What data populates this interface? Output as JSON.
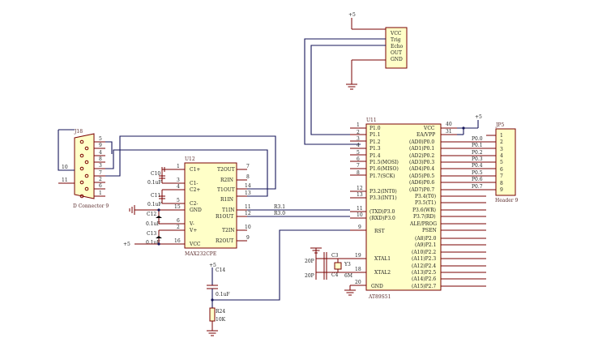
{
  "power": {
    "plus5": "+5"
  },
  "sensor": {
    "pins": [
      "VCC",
      "Trig",
      "Echo",
      "OUT",
      "GND"
    ]
  },
  "u11": {
    "ref": "U11",
    "name": "AT89S51",
    "vcc_pin": "40",
    "ea_pin": "31",
    "left_pins": [
      "P1.0",
      "P1.1",
      "P1.2",
      "P1.3",
      "P1.4",
      "P1.5(MOSI)",
      "P1.6(MISO)",
      "P1.7(SCK)"
    ],
    "left_nums": [
      "1",
      "2",
      "3",
      "4",
      "5",
      "6",
      "7",
      "8"
    ],
    "int_pins": [
      "P3.2(INT0)",
      "P3.3(INT1)"
    ],
    "int_nums": [
      "12",
      "13"
    ],
    "uart_pins": [
      "(TXD)P3.0",
      "(RXD)P3.0"
    ],
    "uart_nums": [
      "11",
      "10"
    ],
    "rst": {
      "label": "RST",
      "num": "9"
    },
    "xtal1": {
      "label": "XTAL1",
      "num": "19"
    },
    "xtal2": {
      "label": "XTAL2",
      "num": "18"
    },
    "gnd": {
      "label": "GND",
      "num": "20"
    },
    "right_top": [
      "VCC",
      "EA/VPP",
      "(AD0)P0.0",
      "(AD1)P0.1",
      "(AD2)P0.2",
      "(AD3)P0.3",
      "(AD4)P0.4",
      "(AD5)P0.5",
      "(AD6)P0.6",
      "(AD7)P0.7",
      "P3.4(T0)",
      "P3.5(T1)",
      "P3.6(WR)",
      "P3.7(RD)",
      "ALE/PROG",
      "PSEN"
    ],
    "right_bottom": [
      "(A8)P2.0",
      "(A9)P2.1",
      "(A10)P2.2",
      "(A11)P2.3",
      "(A12)P2.4",
      "(A13)P2.5",
      "(A14)P2.6",
      "(A15)P2.7"
    ]
  },
  "jp5": {
    "ref": "JP5",
    "name": "Header 9",
    "nets": [
      "P0.0",
      "P0.1",
      "P0.2",
      "P0.3",
      "P0.4",
      "P0.5",
      "P0.6",
      "P0.7"
    ],
    "nums": [
      "1",
      "2",
      "3",
      "4",
      "5",
      "6",
      "7",
      "8",
      "9"
    ]
  },
  "j18": {
    "ref": "J18",
    "name": "D Connector 9",
    "pins": [
      "5",
      "9",
      "4",
      "8",
      "3",
      "7",
      "2",
      "6",
      "1"
    ],
    "side_nums": [
      "10",
      "11"
    ]
  },
  "u12": {
    "ref": "U12",
    "name": "MAX232CPE",
    "left_labels": [
      "C1+",
      "C1-",
      "C2+",
      "C2-",
      "GND",
      "V-",
      "V+",
      "VCC"
    ],
    "left_nums": [
      "1",
      "3",
      "4",
      "5",
      "15",
      "6",
      "2",
      "16"
    ],
    "right_labels": [
      "T2OUT",
      "R2IN",
      "T1OUT",
      "R1IN",
      "T1IN",
      "R1OUT",
      "T2IN",
      "R2OUT"
    ],
    "right_nums": [
      "7",
      "8",
      "14",
      "13",
      "11",
      "12",
      "10",
      "9"
    ]
  },
  "caps_max": [
    {
      "ref": "C10",
      "value": "0.1uF"
    },
    {
      "ref": "C11",
      "value": "0.1uF"
    },
    {
      "ref": "C12",
      "value": "0.1uF"
    },
    {
      "ref": "C13",
      "value": "0.1uF"
    }
  ],
  "uart_nets": [
    "R3.1",
    "R3.0"
  ],
  "c14": {
    "ref": "C14",
    "value": "0.1uF"
  },
  "r24": {
    "ref": "R24",
    "value": "10K"
  },
  "crystal": {
    "c3": "C3",
    "c4": "C4",
    "c_value": "20P",
    "y_ref": "Y3",
    "y_value": "6M"
  }
}
